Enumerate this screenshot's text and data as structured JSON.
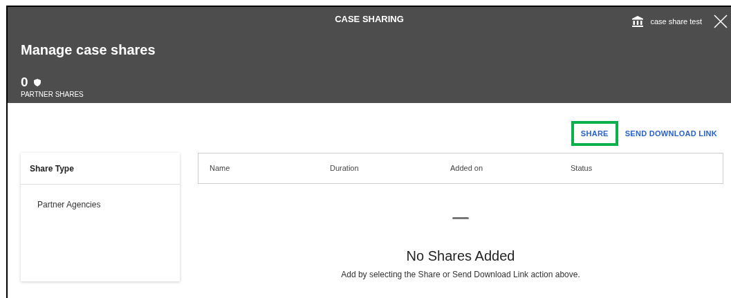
{
  "header": {
    "title": "CASE SHARING",
    "agency": "case share test",
    "heading": "Manage case shares",
    "count": "0",
    "count_label": "PARTNER SHARES"
  },
  "actions": [
    {
      "label": "SHARE",
      "highlighted": true
    },
    {
      "label": "SEND DOWNLOAD LINK",
      "highlighted": false
    }
  ],
  "share_type": {
    "title": "Share Type",
    "items": [
      "Partner Agencies"
    ]
  },
  "table": {
    "columns": [
      "Name",
      "Duration",
      "Added on",
      "Status"
    ]
  },
  "empty_state": {
    "title": "No Shares Added",
    "message": "Add by selecting the Share or Send Download Link action above."
  }
}
